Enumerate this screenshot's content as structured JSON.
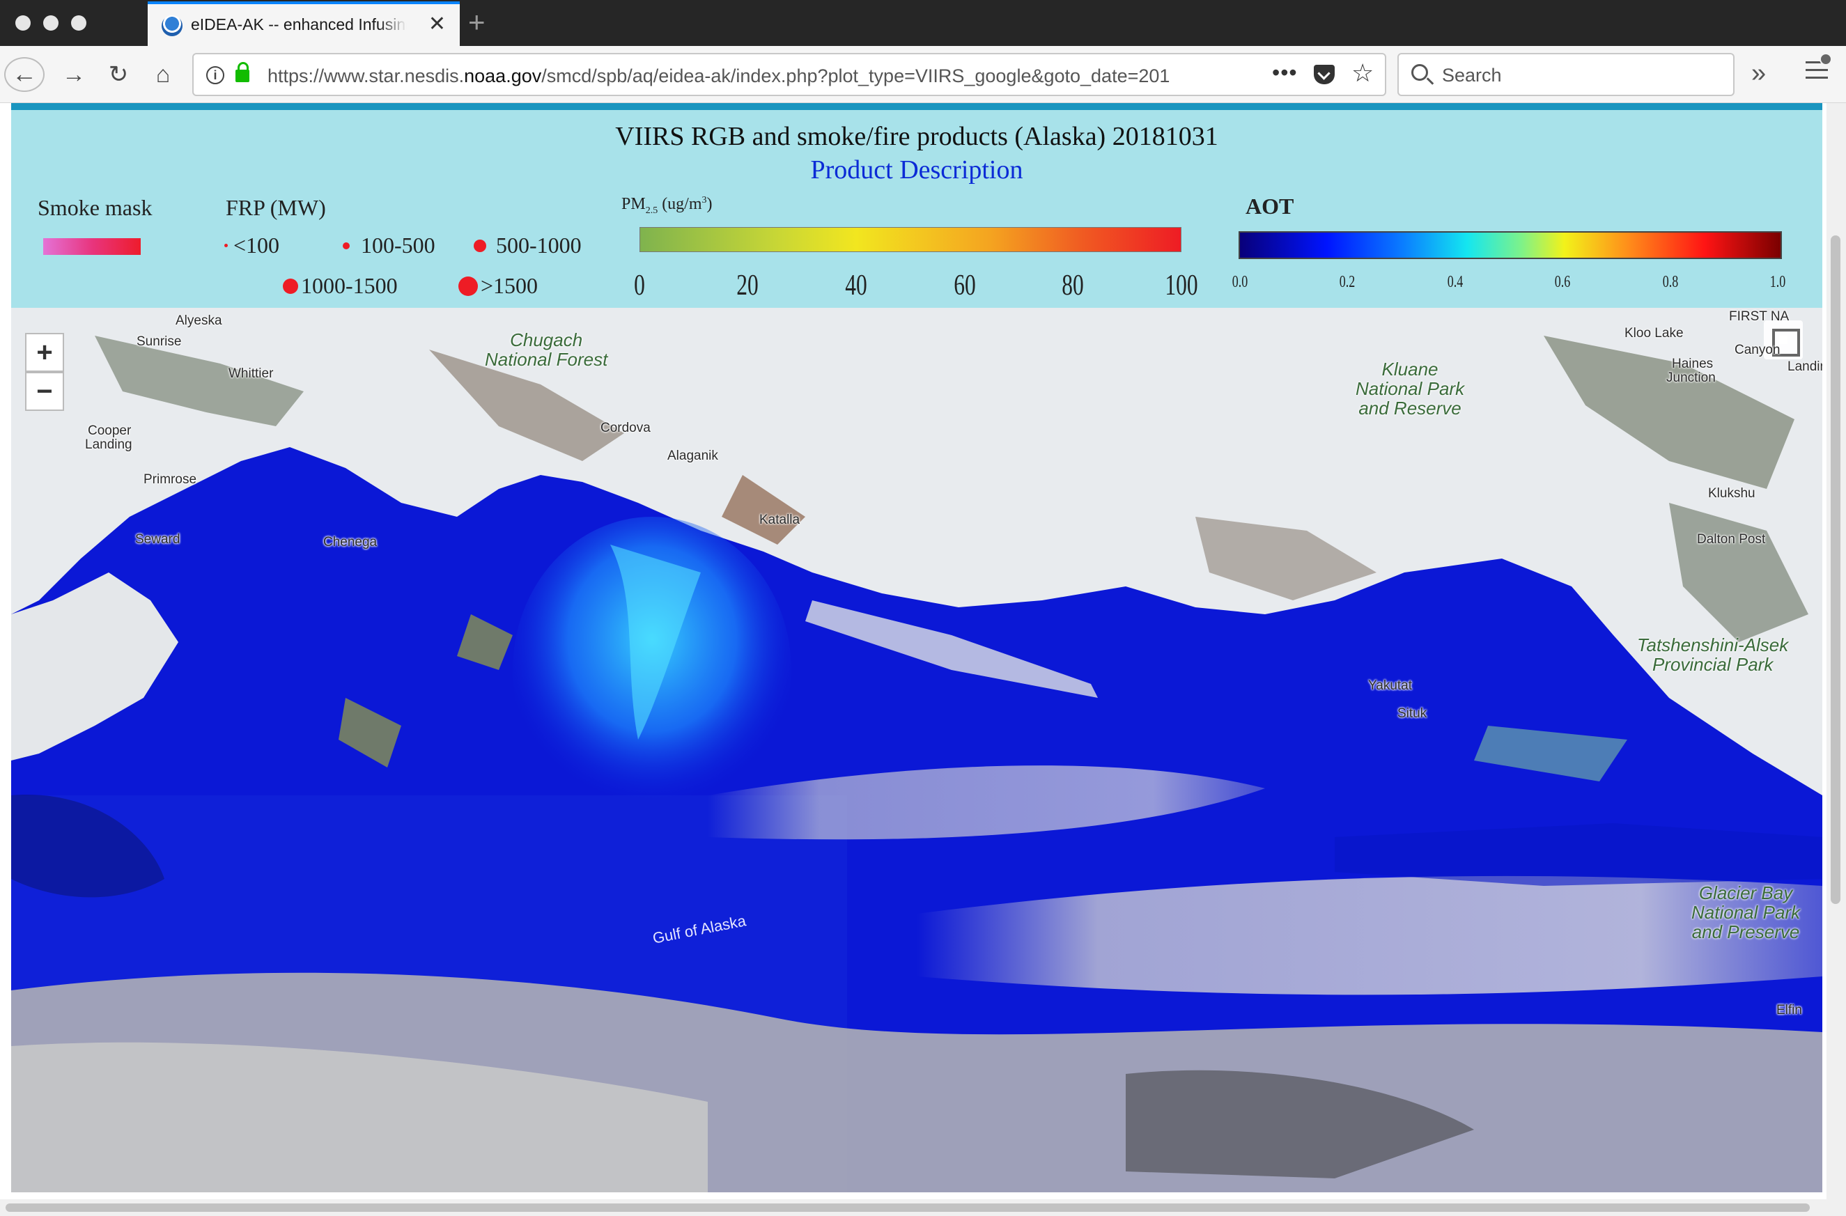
{
  "browser": {
    "tab_title": "eIDEA-AK -- enhanced Infusing",
    "url_prefix": "https://www.star.nesdis.",
    "url_domain": "noaa.gov",
    "url_suffix": "/smcd/spb/aq/eidea-ak/index.php?plot_type=VIIRS_google&goto_date=201",
    "search_placeholder": "Search",
    "icons": [
      "back-arrow-icon",
      "forward-arrow-icon",
      "reload-icon",
      "home-icon",
      "info-icon",
      "lock-icon",
      "more-icon",
      "pocket-icon",
      "star-icon",
      "search-icon",
      "overflow-icon",
      "menu-icon"
    ]
  },
  "header": {
    "title": "VIIRS RGB and smoke/fire products (Alaska) 20181031",
    "product_link": "Product Description",
    "smoke_mask_label": "Smoke mask",
    "frp": {
      "title": "FRP (MW)",
      "items": [
        "<100",
        "100-500",
        "500-1000",
        "1000-1500",
        ">1500"
      ]
    },
    "pm25": {
      "title_prefix": "PM",
      "title_sub": "2.5",
      "title_unit": " (ug/m",
      "title_sup": "3",
      "title_close": ")",
      "ticks": [
        "0",
        "20",
        "40",
        "60",
        "80",
        "100"
      ]
    },
    "aot": {
      "title": "AOT",
      "ticks": [
        "0.0",
        "0.2",
        "0.4",
        "0.6",
        "0.8",
        "1.0"
      ]
    }
  },
  "map": {
    "zoom_in": "+",
    "zoom_out": "−",
    "places": {
      "alyeska": "Alyeska",
      "sunrise": "Sunrise",
      "whittier": "Whittier",
      "cooper_landing_1": "Cooper",
      "cooper_landing_2": "Landing",
      "primrose": "Primrose",
      "seward": "Seward",
      "chenega": "Chenega",
      "cordova": "Cordova",
      "alaganik": "Alaganik",
      "katalla": "Katalla",
      "yakutat": "Yakutat",
      "situk": "Situk",
      "kloo_lake": "Kloo Lake",
      "haines_junction_1": "Haines",
      "haines_junction_2": "Junction",
      "canyon": "Canyon",
      "landing": "Landing",
      "klukshu": "Klukshu",
      "dalton_post": "Dalton Post",
      "elfin": "Elfin",
      "first_na": "FIRST NA"
    },
    "parks": {
      "chugach_1": "Chugach",
      "chugach_2": "National Forest",
      "kluane_1": "Kluane",
      "kluane_2": "National Park",
      "kluane_3": "and Reserve",
      "tatshenshini_1": "Tatshenshini-Alsek",
      "tatshenshini_2": "Provincial Park",
      "glacier_1": "Glacier Bay",
      "glacier_2": "National Park",
      "glacier_3": "and Preserve"
    },
    "water_label": "Gulf of Alaska"
  }
}
